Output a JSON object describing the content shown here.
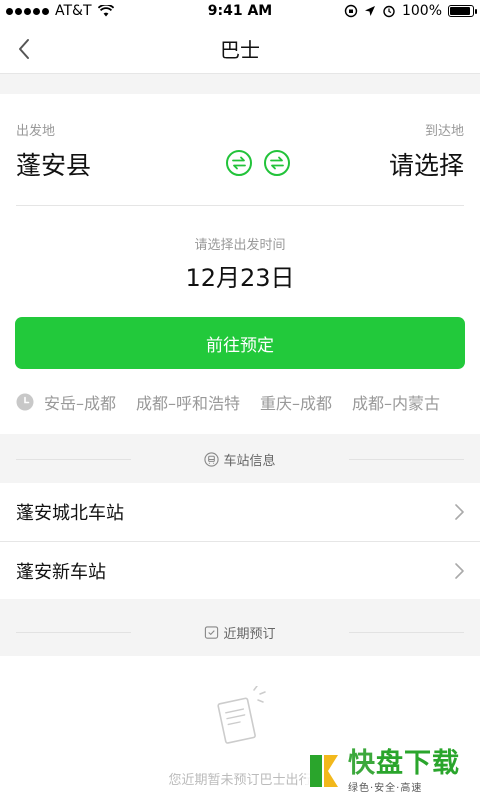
{
  "status_bar": {
    "carrier": "AT&T",
    "time": "9:41 AM",
    "battery": "100%"
  },
  "nav": {
    "title": "巴士"
  },
  "trip": {
    "from_label": "出发地",
    "from_value": "蓬安县",
    "to_label": "到达地",
    "to_value": "请选择",
    "date_label": "请选择出发时间",
    "date_value": "12月23日",
    "book_button": "前往预定"
  },
  "history": [
    "安岳–成都",
    "成都–呼和浩特",
    "重庆–成都",
    "成都–内蒙古"
  ],
  "stations_section": {
    "title": "车站信息",
    "items": [
      {
        "name": "蓬安城北车站"
      },
      {
        "name": "蓬安新车站"
      }
    ]
  },
  "recent_section": {
    "title": "近期预订",
    "empty_text": "您近期暂未预订巴士出行"
  },
  "watermark": {
    "brand_kuai": "快",
    "brand_rest": "盘下载",
    "tagline": "绿色·安全·高速"
  },
  "colors": {
    "accent": "#22c93b",
    "muted": "#999999"
  }
}
